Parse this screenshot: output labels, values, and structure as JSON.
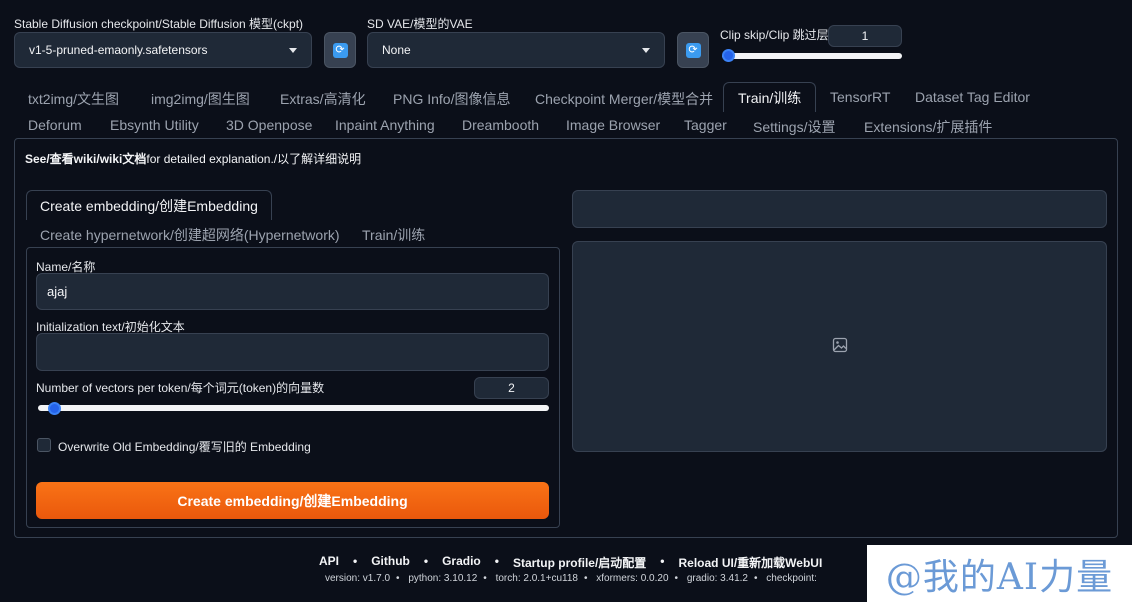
{
  "checkpoint": {
    "label": "Stable Diffusion checkpoint/Stable Diffusion 模型(ckpt)",
    "value": "v1-5-pruned-emaonly.safetensors"
  },
  "vae": {
    "label": "SD VAE/模型的VAE",
    "value": "None"
  },
  "clip_skip": {
    "label": "Clip skip/Clip 跳过层",
    "value": "1",
    "fraction": 0.0
  },
  "tabs_row1": [
    "txt2img/文生图",
    "img2img/图生图",
    "Extras/高清化",
    "PNG Info/图像信息",
    "Checkpoint Merger/模型合并",
    "Train/训练",
    "TensorRT",
    "Dataset Tag Editor"
  ],
  "tabs_row2": [
    "Deforum",
    "Ebsynth Utility",
    "3D Openpose",
    "Inpaint Anything",
    "Dreambooth",
    "Image Browser",
    "Tagger",
    "Settings/设置",
    "Extensions/扩展插件"
  ],
  "info": {
    "prefix": "See/查看wiki/wiki文档",
    "suffix": "for detailed explanation./以了解详细说明"
  },
  "subtabs": {
    "active": "Create embedding/创建Embedding",
    "hypernetwork": "Create hypernetwork/创建超网络(Hypernetwork)",
    "train": "Train/训练"
  },
  "form": {
    "name_label": "Name/名称",
    "name_value": "ajaj",
    "init_label": "Initialization text/初始化文本",
    "init_value": "",
    "vectors_label": "Number of vectors per token/每个词元(token)的向量数",
    "vectors_value": "2",
    "vectors_fraction": 0.02,
    "overwrite_label": "Overwrite Old Embedding/覆写旧的 Embedding",
    "create_button": "Create embedding/创建Embedding"
  },
  "icons": {
    "refresh": "refresh-icon",
    "image_placeholder": "image-icon",
    "caret": "chevron-down-icon"
  },
  "colors": {
    "accent": "#f97316",
    "slider": "#2563eb",
    "refresh": "#3b9bf0",
    "background": "#0b0f19"
  },
  "footer": {
    "links": [
      "API",
      "Github",
      "Gradio",
      "Startup profile/启动配置",
      "Reload UI/重新加载WebUI"
    ],
    "versions": [
      "version: v1.7.0",
      "python: 3.10.12",
      "torch: 2.0.1+cu118",
      "xformers: 0.0.20",
      "gradio: 3.41.2",
      "checkpoint:"
    ]
  },
  "watermark": "@我的AI力量"
}
